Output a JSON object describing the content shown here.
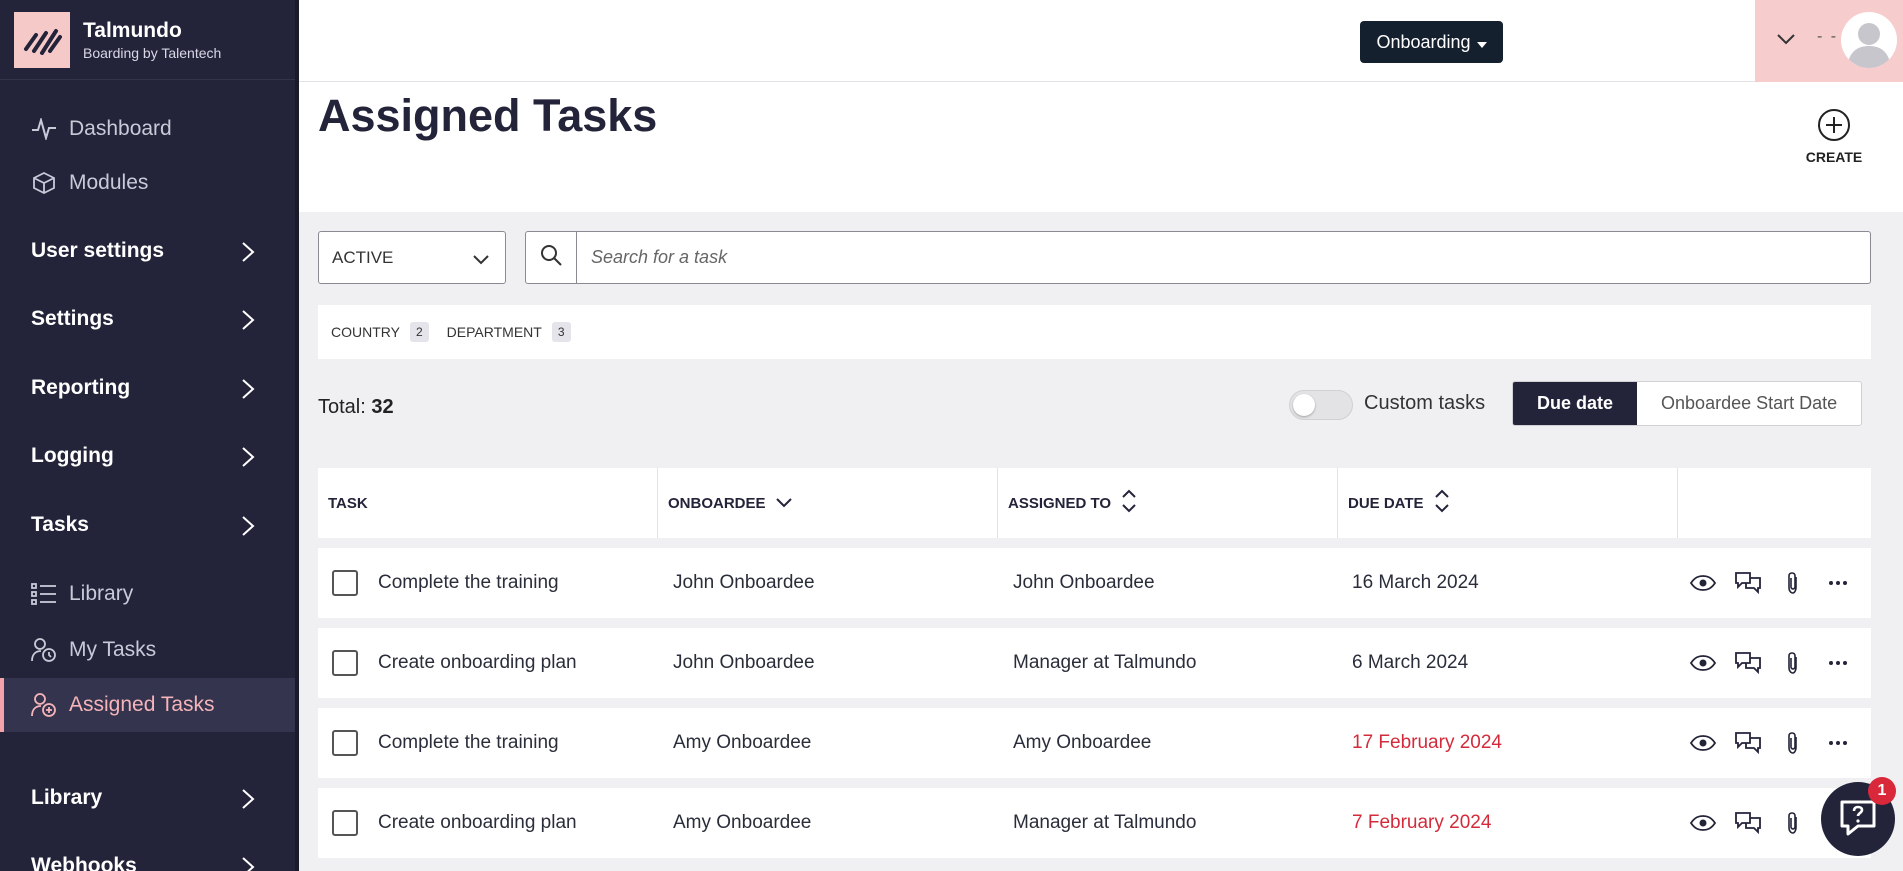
{
  "brand": {
    "name": "Talmundo",
    "subtitle": "Boarding by Talentech"
  },
  "sidebar": {
    "items": [
      {
        "label": "Dashboard",
        "icon": "activity-icon"
      },
      {
        "label": "Modules",
        "icon": "cube-icon"
      },
      {
        "label": "User settings",
        "icon": "chevron-right-icon"
      },
      {
        "label": "Settings",
        "icon": "chevron-right-icon"
      },
      {
        "label": "Reporting",
        "icon": "chevron-right-icon"
      },
      {
        "label": "Logging",
        "icon": "chevron-right-icon"
      },
      {
        "label": "Tasks",
        "icon": "chevron-right-icon"
      },
      {
        "label": "Library",
        "icon": "list-icon"
      },
      {
        "label": "My Tasks",
        "icon": "user-clock-icon"
      },
      {
        "label": "Assigned Tasks",
        "icon": "user-plus-icon",
        "active": true
      },
      {
        "label": "Library",
        "icon": "chevron-right-icon"
      },
      {
        "label": "Webhooks",
        "icon": "chevron-right-icon"
      }
    ]
  },
  "topbar": {
    "module_label": "Onboarding",
    "user_name": "- -"
  },
  "page": {
    "title": "Assigned Tasks",
    "create_label": "CREATE"
  },
  "filters": {
    "status_value": "ACTIVE",
    "search_placeholder": "Search for a task",
    "chips": [
      {
        "label": "COUNTRY",
        "count": "2"
      },
      {
        "label": "DEPARTMENT",
        "count": "3"
      }
    ]
  },
  "summary": {
    "total_label": "Total:",
    "total_value": "32",
    "toggle_label": "Custom tasks",
    "toggle_on": false,
    "sort_options": [
      "Due date",
      "Onboardee Start Date"
    ],
    "sort_selected": "Due date"
  },
  "table": {
    "headers": [
      "TASK",
      "ONBOARDEE",
      "ASSIGNED TO",
      "DUE DATE"
    ],
    "rows": [
      {
        "task": "Complete the training",
        "onboardee": "John Onboardee",
        "assigned_to": "John Onboardee",
        "due": "16 March 2024",
        "overdue": false
      },
      {
        "task": "Create onboarding plan",
        "onboardee": "John Onboardee",
        "assigned_to": "Manager at Talmundo",
        "due": "6 March 2024",
        "overdue": false
      },
      {
        "task": "Complete the training",
        "onboardee": "Amy Onboardee",
        "assigned_to": "Amy Onboardee",
        "due": "17 February 2024",
        "overdue": true
      },
      {
        "task": "Create onboarding plan",
        "onboardee": "Amy Onboardee",
        "assigned_to": "Manager at Talmundo",
        "due": "7 February 2024",
        "overdue": true
      }
    ],
    "row_actions": [
      "eye-icon",
      "comments-icon",
      "paperclip-icon",
      "more-icon"
    ]
  },
  "help": {
    "badge": "1"
  },
  "colors": {
    "sidebar_bg": "#23233a",
    "accent_pink": "#f5b4b9",
    "overdue_red": "#d32b3b"
  }
}
